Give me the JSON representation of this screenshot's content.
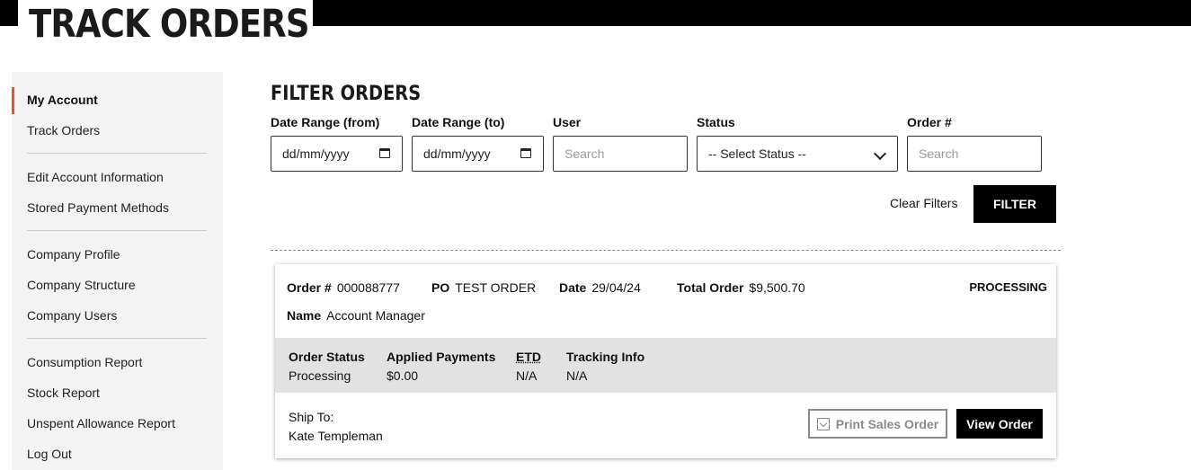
{
  "header": {
    "title": "TRACK ORDERS"
  },
  "sidebar": {
    "items": [
      {
        "label": "My Account",
        "active": true
      },
      {
        "label": "Track Orders"
      },
      {
        "label": "Edit Account Information"
      },
      {
        "label": "Stored Payment Methods"
      },
      {
        "label": "Company Profile"
      },
      {
        "label": "Company Structure"
      },
      {
        "label": "Company Users"
      },
      {
        "label": "Consumption Report"
      },
      {
        "label": "Stock Report"
      },
      {
        "label": "Unspent Allowance Report"
      },
      {
        "label": "Log Out"
      }
    ]
  },
  "filters": {
    "title": "FILTER ORDERS",
    "date_from": {
      "label": "Date Range (from)",
      "value": "dd/mm/yyyy"
    },
    "date_to": {
      "label": "Date Range (to)",
      "value": "dd/mm/yyyy"
    },
    "user": {
      "label": "User",
      "placeholder": "Search"
    },
    "status": {
      "label": "Status",
      "selected": "-- Select Status --"
    },
    "order_number": {
      "label": "Order #",
      "placeholder": "Search"
    },
    "clear_label": "Clear Filters",
    "filter_label": "FILTER"
  },
  "order": {
    "order_number_label": "Order #",
    "order_number": "000088777",
    "po_label": "PO",
    "po": "TEST ORDER",
    "date_label": "Date",
    "date": "29/04/24",
    "total_label": "Total Order",
    "total": "$9,500.70",
    "status_tag": "PROCESSING",
    "name_label": "Name",
    "name": "Account Manager",
    "details": {
      "order_status_label": "Order Status",
      "order_status": "Processing",
      "applied_payments_label": "Applied Payments",
      "applied_payments": "$0.00",
      "etd_label": "ETD",
      "etd": "N/A",
      "tracking_label": "Tracking Info",
      "tracking": "N/A"
    },
    "ship_to_label": "Ship To:",
    "ship_to": "Kate Templeman",
    "print_label": "Print Sales Order",
    "view_label": "View Order"
  },
  "colors": {
    "accent": "#e4572e",
    "band": "#e2e2e2",
    "sidebar_bg": "#f3f3f3"
  }
}
